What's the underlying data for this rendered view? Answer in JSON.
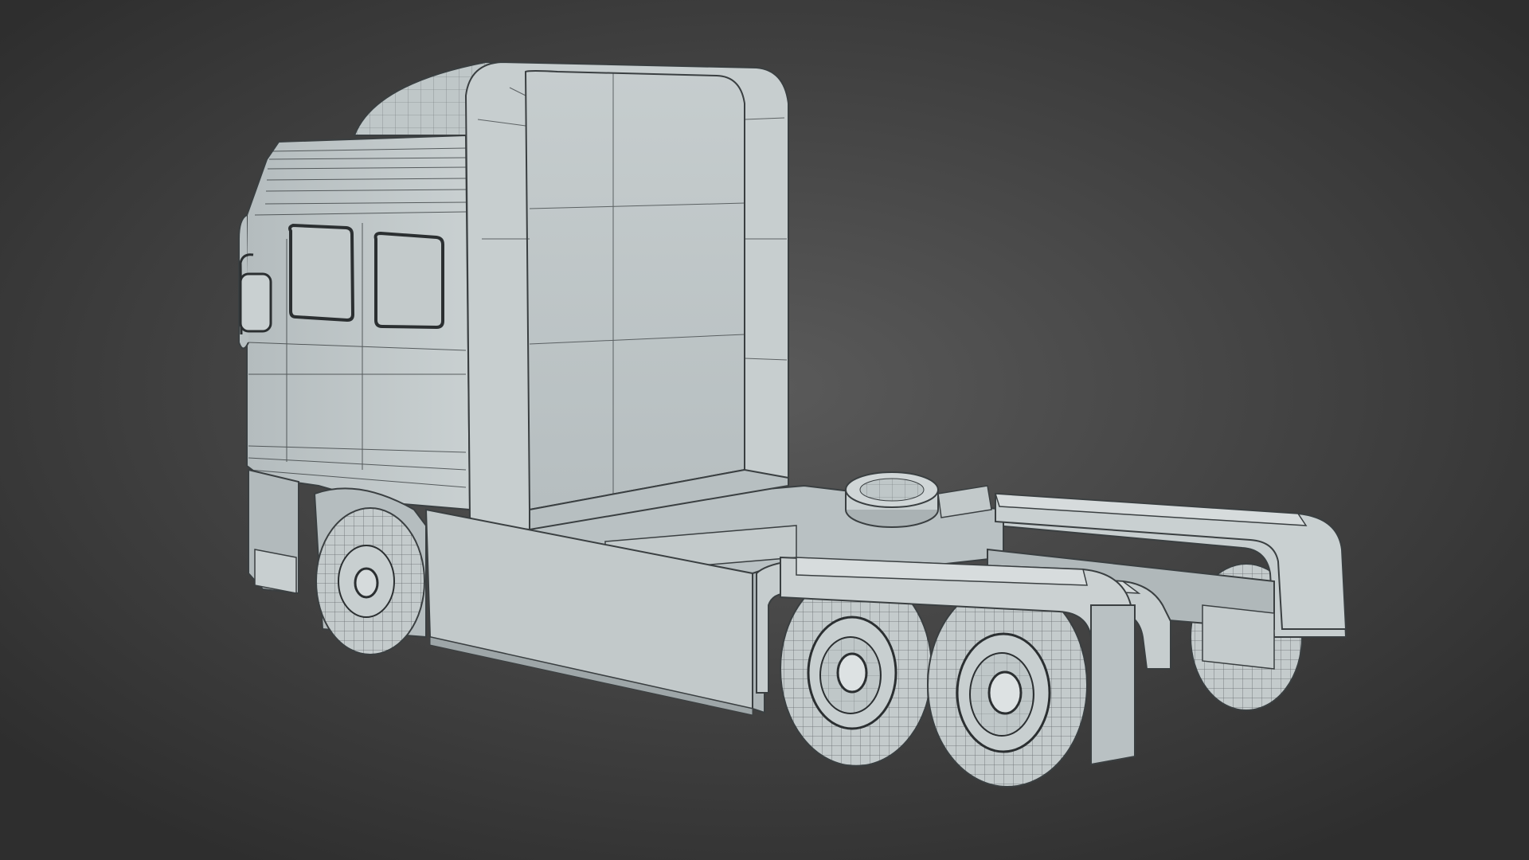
{
  "scene": {
    "subject": "truck-tractor-wireframe-render",
    "colors": {
      "background_center": "#5a5a5a",
      "background_edge": "#2e2e2e",
      "body": "#bfc7c8",
      "body_light": "#d3d9da",
      "body_shadow": "#9aa3a5",
      "tire": "#c4cbcc",
      "wire": "#3a3f41"
    }
  }
}
